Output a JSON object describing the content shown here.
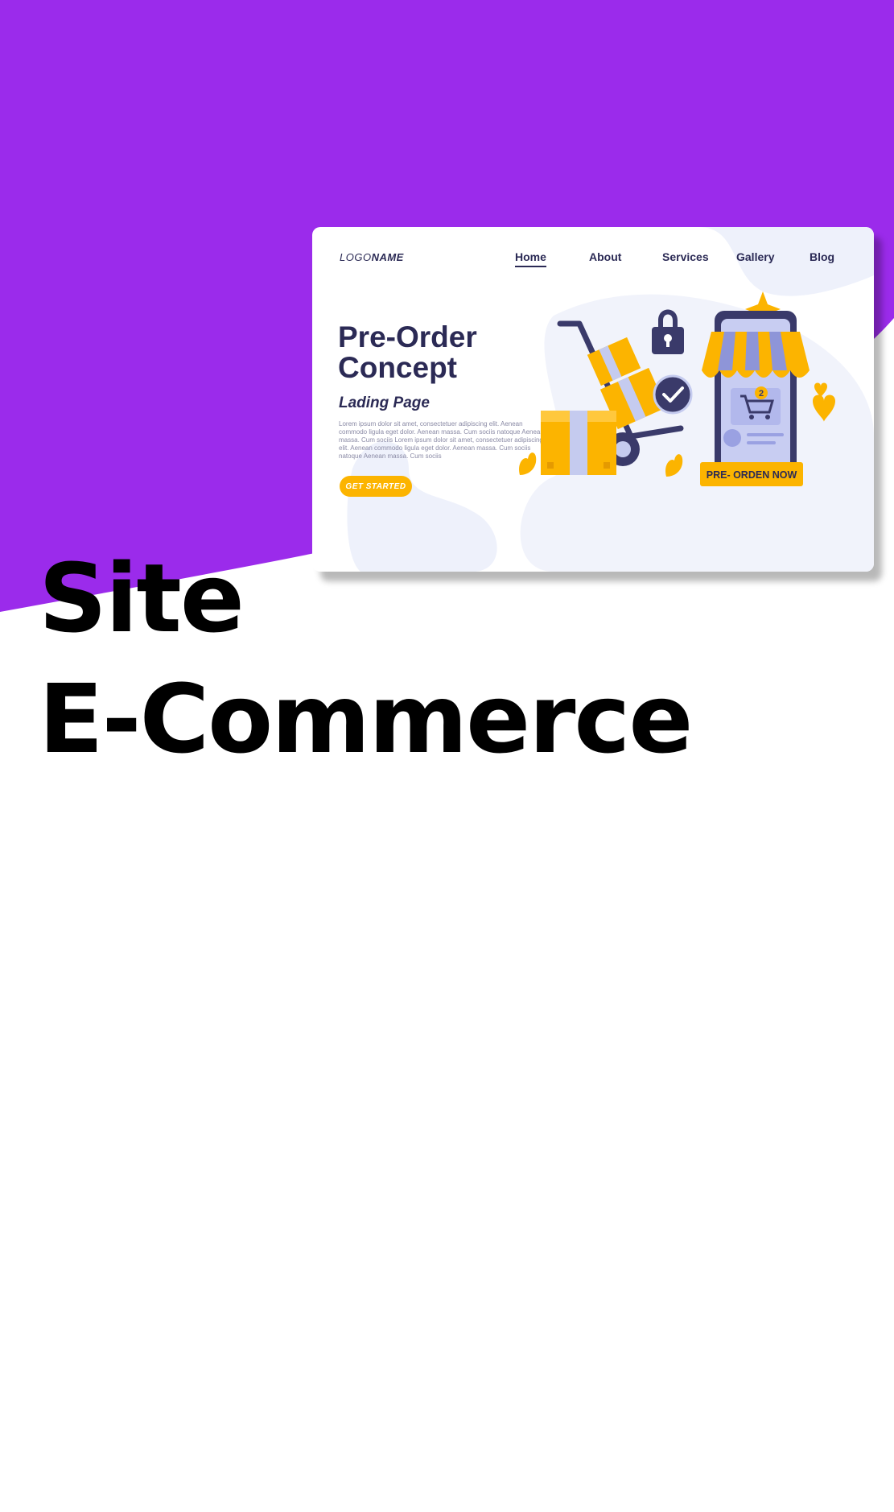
{
  "colors": {
    "brand_purple": "#9b2beb",
    "navy": "#2b2a55",
    "accent_yellow": "#fcb400",
    "headline": "#000000"
  },
  "headline": {
    "line1": "Site",
    "line2": "E-Commerce"
  },
  "mockup": {
    "logo_italic": "LOGO",
    "logo_bold": "NAME",
    "nav": {
      "home": "Home",
      "about": "About",
      "services": "Services",
      "gallery": "Gallery",
      "blog": "Blog"
    },
    "active_nav": "Home",
    "hero_title": "Pre-Order Concept",
    "hero_subtitle": "Lading Page",
    "hero_body": "Lorem ipsum dolor sit amet, consectetuer adipiscing elit. Aenean commodo ligula eget dolor. Aenean massa. Cum sociis natoque Aenean massa. Cum sociis Lorem ipsum dolor sit amet, consectetuer adipiscing elit. Aenean commodo ligula eget dolor. Aenean massa. Cum sociis natoque Aenean massa. Cum sociis",
    "cta_label": "GET STARTED",
    "badge_label": "PRE- ORDEN NOW",
    "cart_count": "2",
    "icons": [
      "lock-icon",
      "check-icon",
      "shopping-cart-icon",
      "heart-icon",
      "sparkle-icon"
    ]
  }
}
